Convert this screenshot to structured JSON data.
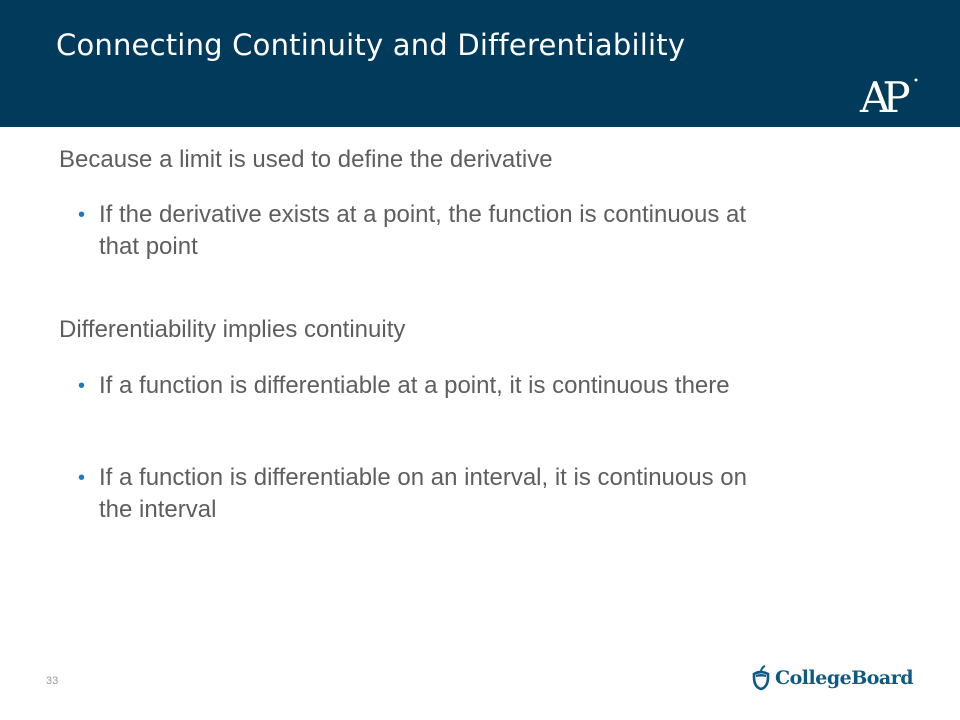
{
  "slide": {
    "title": "Connecting Continuity and Differentiability",
    "logo": "AP",
    "sections": [
      {
        "heading": "Because a limit is used to define the derivative",
        "bullets": [
          "If the derivative exists at a point, the function is continuous at that point"
        ]
      },
      {
        "heading": "Differentiability implies continuity",
        "bullets": [
          "If a function is differentiable at a point, it is continuous there",
          "If a function is differentiable on an interval, it is continuous on the interval"
        ]
      }
    ],
    "bullet_glyph": "•",
    "page_number": "33",
    "footer_brand": "CollegeBoard",
    "colors": {
      "header_bg": "#023a5c",
      "text": "#5e5e5e",
      "bullet": "#1a7ac1",
      "brand": "#0f5a84"
    }
  }
}
